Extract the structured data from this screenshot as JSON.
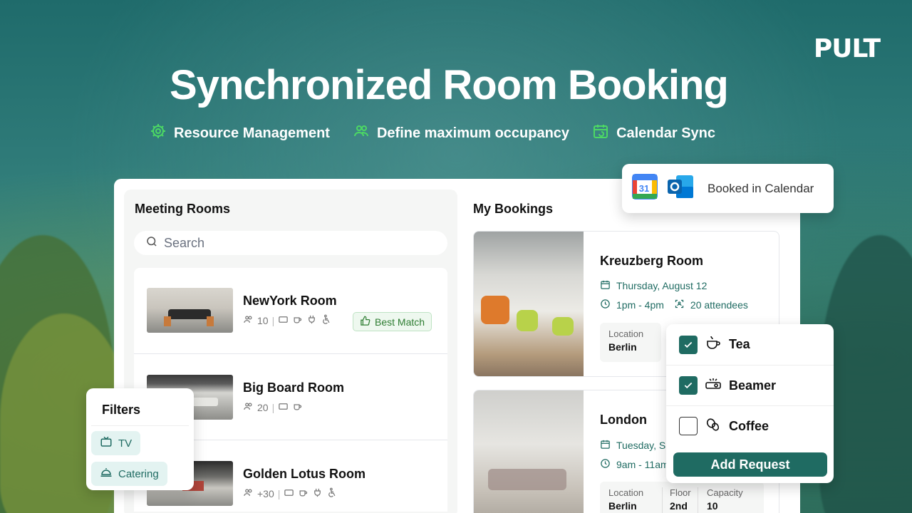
{
  "brand": {
    "logo": "PULT"
  },
  "hero": {
    "title": "Synchronized Room Booking",
    "features": [
      {
        "icon": "gear-icon",
        "label": "Resource Management"
      },
      {
        "icon": "users-icon",
        "label": "Define maximum occupancy"
      },
      {
        "icon": "calendar-sync-icon",
        "label": "Calendar Sync"
      }
    ]
  },
  "meeting_rooms": {
    "title": "Meeting Rooms",
    "search_placeholder": "Search",
    "rooms": [
      {
        "name": "NewYork Room",
        "capacity": "10",
        "badge": "Best Match"
      },
      {
        "name": "Big Board Room",
        "capacity": "20"
      },
      {
        "name": "Golden Lotus Room",
        "capacity": "+30"
      }
    ]
  },
  "my_bookings": {
    "title": "My Bookings",
    "bookings": [
      {
        "name": "Kreuzberg Room",
        "date": "Thursday, August 12",
        "time": "1pm - 4pm",
        "attendees": "20 attendees",
        "location_label": "Location",
        "location": "Berlin"
      },
      {
        "name": "London",
        "date": "Tuesday, S",
        "time": "9am - 11am",
        "location_label": "Location",
        "location": "Berlin",
        "floor_label": "Floor",
        "floor": "2nd",
        "capacity_label": "Capacity",
        "capacity": "10"
      }
    ]
  },
  "calendar_popup": {
    "label": "Booked in Calendar",
    "google_day": "31"
  },
  "request_popup": {
    "items": [
      {
        "label": "Tea",
        "checked": true
      },
      {
        "label": "Beamer",
        "checked": true
      },
      {
        "label": "Coffee",
        "checked": false
      }
    ],
    "button": "Add Request"
  },
  "filters": {
    "title": "Filters",
    "chips": [
      "TV",
      "Catering"
    ]
  },
  "colors": {
    "accent": "#1f6b62",
    "badge_green": "#2e7d32",
    "icon_green": "#4cd964"
  }
}
